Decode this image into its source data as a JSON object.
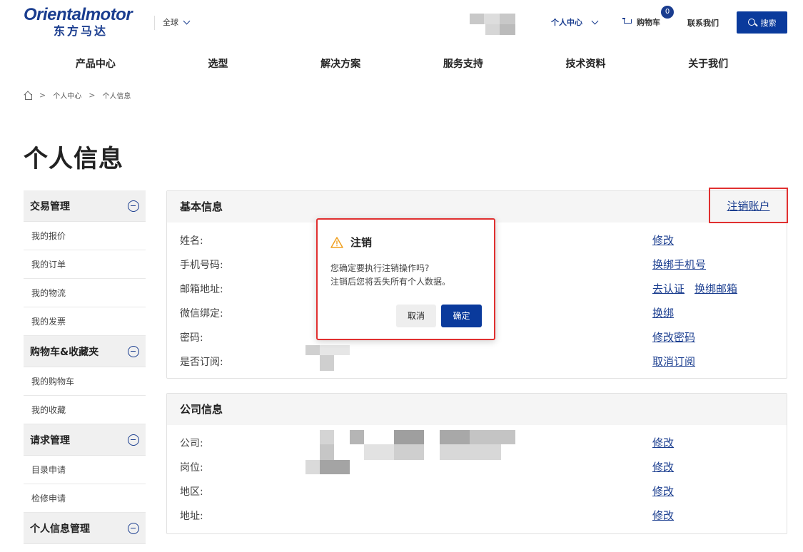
{
  "header": {
    "logo_en": "Orientalmotor",
    "logo_cn": "东方马达",
    "region": "全球",
    "user_center": "个人中心",
    "cart_label": "购物车",
    "cart_count": "0",
    "contact": "联系我们",
    "search_label": "搜索"
  },
  "nav": {
    "items": [
      "产品中心",
      "选型",
      "解决方案",
      "服务支持",
      "技术资料",
      "关于我们"
    ]
  },
  "breadcrumb": {
    "items": [
      "个人中心",
      "个人信息"
    ],
    "separator": ">"
  },
  "page_title": "个人信息",
  "sidebar": {
    "groups": [
      {
        "label": "交易管理",
        "items": [
          "我的报价",
          "我的订单",
          "我的物流",
          "我的发票"
        ]
      },
      {
        "label": "购物车&收藏夹",
        "items": [
          "我的购物车",
          "我的收藏"
        ]
      },
      {
        "label": "请求管理",
        "items": [
          "目录申请",
          "检修申请"
        ]
      },
      {
        "label": "个人信息管理",
        "items": []
      }
    ]
  },
  "basic_info": {
    "title": "基本信息",
    "cancel_account": "注销账户",
    "rows": [
      {
        "label": "姓名:",
        "links": [
          "修改"
        ]
      },
      {
        "label": "手机号码:",
        "links": [
          "换绑手机号"
        ]
      },
      {
        "label": "邮箱地址:",
        "links": [
          "去认证",
          "换绑邮箱"
        ]
      },
      {
        "label": "微信绑定:",
        "links": [
          "换绑"
        ]
      },
      {
        "label": "密码:",
        "links": [
          "修改密码"
        ]
      },
      {
        "label": "是否订阅:",
        "links": [
          "取消订阅"
        ]
      }
    ]
  },
  "company_info": {
    "title": "公司信息",
    "rows": [
      {
        "label": "公司:",
        "links": [
          "修改"
        ]
      },
      {
        "label": "岗位:",
        "links": [
          "修改"
        ]
      },
      {
        "label": "地区:",
        "links": [
          "修改"
        ]
      },
      {
        "label": "地址:",
        "links": [
          "修改"
        ]
      }
    ]
  },
  "modal": {
    "title": "注销",
    "line1": "您确定要执行注销操作吗?",
    "line2": "注销后您将丢失所有个人数据。",
    "cancel": "取消",
    "confirm": "确定"
  },
  "colors": {
    "brand": "#1a3d8f",
    "primary_button": "#0a3a9c",
    "highlight": "#e03030",
    "warning": "#f0a020"
  }
}
